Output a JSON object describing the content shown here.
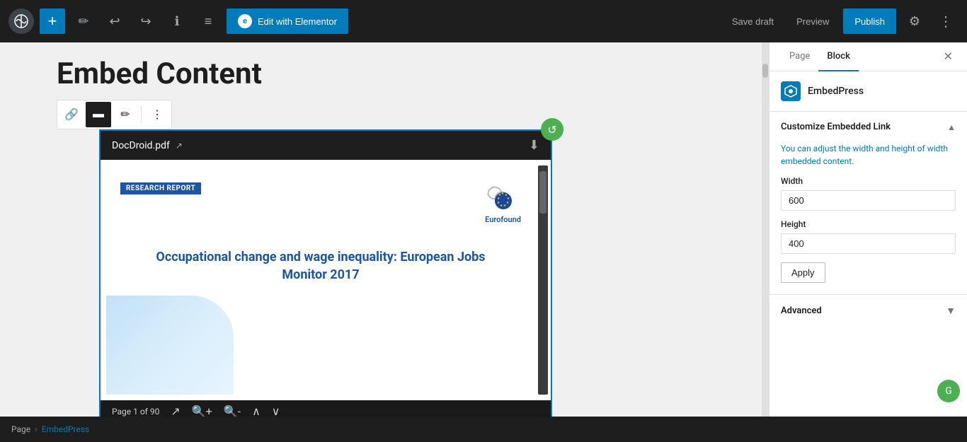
{
  "topbar": {
    "add_button_label": "+",
    "edit_with_elementor": "Edit with Elementor",
    "save_draft": "Save draft",
    "preview": "Preview",
    "publish": "Publish"
  },
  "editor": {
    "title": "Embed Content",
    "embed_file": "DocDroid.pdf",
    "research_badge": "RESEARCH REPORT",
    "pdf_title": "Occupational change and wage inequality: European Jobs Monitor 2017",
    "eurofound": "Eurofound",
    "page_info": "Page 1 of 90"
  },
  "panel": {
    "tab_page": "Page",
    "tab_block": "Block",
    "embedpress_title": "EmbedPress",
    "customize_section": {
      "title": "Customize Embedded Link",
      "description_part1": "You can adjust the width and height of",
      "description_part2": "embedded content.",
      "description_link": "width",
      "width_label": "Width",
      "width_value": "600",
      "height_label": "Height",
      "height_value": "400",
      "apply_label": "Apply"
    },
    "advanced_section": {
      "title": "Advanced"
    }
  },
  "breadcrumb": {
    "page_label": "Page",
    "separator": "›",
    "current": "EmbedPress"
  }
}
